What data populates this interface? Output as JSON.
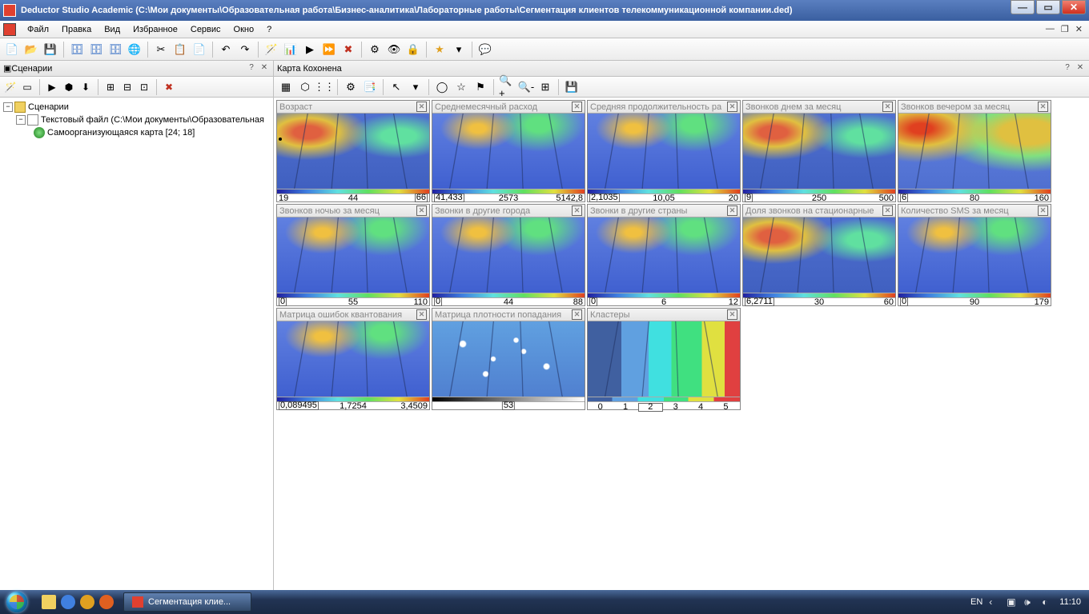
{
  "window": {
    "title": "Deductor Studio Academic (С:\\Мои документы\\Образовательная работа\\Бизнес-аналитика\\Лабораторные работы\\Сегментация клиентов телекоммуникационной компании.ded)"
  },
  "menu": {
    "file": "Файл",
    "edit": "Правка",
    "view": "Вид",
    "fav": "Избранное",
    "service": "Сервис",
    "window": "Окно",
    "help": "?"
  },
  "sidebar": {
    "title": "Сценарии",
    "tree": {
      "root": "Сценарии",
      "file": "Текстовый файл (С:\\Мои документы\\Образовательная",
      "som": "Самоорганизующаяся карта [24; 18]"
    }
  },
  "content": {
    "title": "Карта Кохонена"
  },
  "maps": [
    {
      "title": "Возраст",
      "min": "19",
      "mid": "44",
      "max": "66",
      "box": "max",
      "hm": "hm-mixed",
      "dot": true
    },
    {
      "title": "Среднемесячный расход",
      "min": "41,433",
      "mid": "2573",
      "max": "5142,8",
      "box": "min",
      "hm": "hm-blue"
    },
    {
      "title": "Средняя продолжительность ра",
      "min": "2,1035",
      "mid": "10,05",
      "max": "20",
      "box": "min",
      "hm": "hm-blue"
    },
    {
      "title": "Звонков днем за месяц",
      "min": "9",
      "mid": "250",
      "max": "500",
      "box": "min",
      "hm": "hm-mixed"
    },
    {
      "title": "Звонков вечером за месяц",
      "min": "6",
      "mid": "80",
      "max": "160",
      "box": "min",
      "hm": "hm-yellow"
    },
    {
      "title": "Звонков ночью за месяц",
      "min": "0",
      "mid": "55",
      "max": "110",
      "box": "min",
      "hm": "hm-blue"
    },
    {
      "title": "Звонки в другие города",
      "min": "0",
      "mid": "44",
      "max": "88",
      "box": "min",
      "hm": "hm-blue"
    },
    {
      "title": "Звонки в другие страны",
      "min": "0",
      "mid": "6",
      "max": "12",
      "box": "min",
      "hm": "hm-blue"
    },
    {
      "title": "Доля звонков на стационарные",
      "min": "6,2711",
      "mid": "30",
      "max": "60",
      "box": "min",
      "hm": "hm-mixed"
    },
    {
      "title": "Количество SMS за месяц",
      "min": "0",
      "mid": "90",
      "max": "179",
      "box": "min",
      "hm": "hm-blue"
    },
    {
      "title": "Матрица ошибок квантования",
      "min": "0,089495",
      "mid": "1,7254",
      "max": "3,4509",
      "box": "min",
      "hm": "hm-blue"
    },
    {
      "title": "Матрица плотности попадания",
      "min": "",
      "mid": "53",
      "max": "",
      "box": "mid",
      "hm": "hm-density",
      "grad": "bw"
    },
    {
      "title": "Кластеры",
      "cluster": true,
      "labels": [
        "0",
        "1",
        "2",
        "3",
        "4",
        "5"
      ],
      "box": "2",
      "hm": "hm-cluster",
      "grad": "cluster"
    }
  ],
  "taskbar": {
    "app": "Сегментация клие...",
    "lang": "EN",
    "time": "11:10"
  },
  "chart_data": {
    "type": "heatmap",
    "description": "Kohonen self-organizing map grid 24x18, 13 component planes",
    "grid": [
      24,
      18
    ],
    "components": [
      {
        "name": "Возраст",
        "range": [
          19,
          66
        ]
      },
      {
        "name": "Среднемесячный расход",
        "range": [
          41.433,
          5142.8
        ]
      },
      {
        "name": "Средняя продолжительность разговора",
        "range": [
          2.1035,
          20
        ]
      },
      {
        "name": "Звонков днем за месяц",
        "range": [
          9,
          500
        ]
      },
      {
        "name": "Звонков вечером за месяц",
        "range": [
          6,
          160
        ]
      },
      {
        "name": "Звонков ночью за месяц",
        "range": [
          0,
          110
        ]
      },
      {
        "name": "Звонки в другие города",
        "range": [
          0,
          88
        ]
      },
      {
        "name": "Звонки в другие страны",
        "range": [
          0,
          12
        ]
      },
      {
        "name": "Доля звонков на стационарные",
        "range": [
          6.2711,
          60
        ]
      },
      {
        "name": "Количество SMS за месяц",
        "range": [
          0,
          179
        ]
      },
      {
        "name": "Матрица ошибок квантования",
        "range": [
          0.089495,
          3.4509
        ]
      },
      {
        "name": "Матрица плотности попадания",
        "range": [
          0,
          53
        ]
      },
      {
        "name": "Кластеры",
        "range": [
          0,
          5
        ],
        "clusters": 6
      }
    ]
  }
}
